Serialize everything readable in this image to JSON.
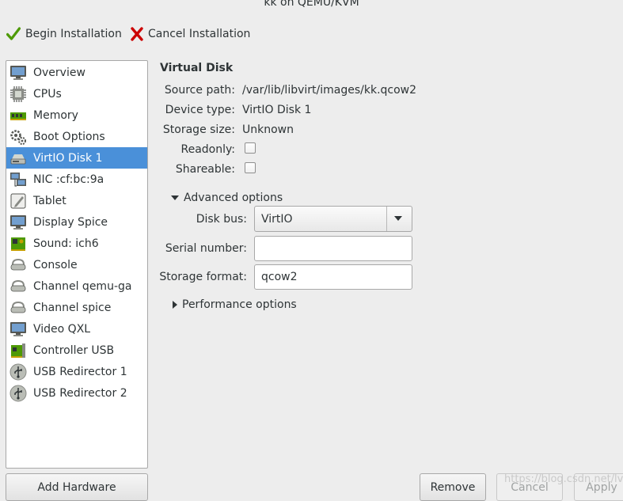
{
  "window": {
    "title": "kk on QEMU/KVM"
  },
  "toolbar": {
    "begin_label": "Begin Installation",
    "begin_icon": "checkmark-icon",
    "cancel_label": "Cancel Installation",
    "cancel_icon": "x-mark-icon"
  },
  "sidebar": {
    "items": [
      {
        "label": "Overview",
        "icon": "monitor-icon"
      },
      {
        "label": "CPUs",
        "icon": "cpu-chip-icon"
      },
      {
        "label": "Memory",
        "icon": "memory-module-icon"
      },
      {
        "label": "Boot Options",
        "icon": "gears-icon"
      },
      {
        "label": "VirtIO Disk 1",
        "icon": "hard-disk-icon",
        "selected": true
      },
      {
        "label": "NIC :cf:bc:9a",
        "icon": "network-icon"
      },
      {
        "label": "Tablet",
        "icon": "tablet-icon"
      },
      {
        "label": "Display Spice",
        "icon": "monitor-icon"
      },
      {
        "label": "Sound: ich6",
        "icon": "sound-card-icon"
      },
      {
        "label": "Console",
        "icon": "serial-device-icon"
      },
      {
        "label": "Channel qemu-ga",
        "icon": "serial-device-icon"
      },
      {
        "label": "Channel spice",
        "icon": "serial-device-icon"
      },
      {
        "label": "Video QXL",
        "icon": "monitor-icon"
      },
      {
        "label": "Controller USB",
        "icon": "controller-card-icon"
      },
      {
        "label": "USB Redirector 1",
        "icon": "usb-icon"
      },
      {
        "label": "USB Redirector 2",
        "icon": "usb-icon"
      }
    ],
    "add_hardware_label": "Add Hardware"
  },
  "details": {
    "heading": "Virtual Disk",
    "source_path_label": "Source path:",
    "source_path_value": "/var/lib/libvirt/images/kk.qcow2",
    "device_type_label": "Device type:",
    "device_type_value": "VirtIO Disk 1",
    "storage_size_label": "Storage size:",
    "storage_size_value": "Unknown",
    "readonly_label": "Readonly:",
    "readonly_checked": false,
    "shareable_label": "Shareable:",
    "shareable_checked": false,
    "advanced_label": "Advanced options",
    "disk_bus_label": "Disk bus:",
    "disk_bus_value": "VirtIO",
    "serial_label": "Serial number:",
    "serial_value": "",
    "format_label": "Storage format:",
    "format_value": "qcow2",
    "performance_label": "Performance options"
  },
  "footer": {
    "remove_label": "Remove",
    "cancel_label": "Cancel",
    "apply_label": "Apply",
    "watermark": "https://blog.csdn.net/lvly"
  },
  "colors": {
    "selection": "#4a90d9",
    "window_bg": "#ededed",
    "check_green": "#4e9a06",
    "cross_red": "#cc0000"
  }
}
